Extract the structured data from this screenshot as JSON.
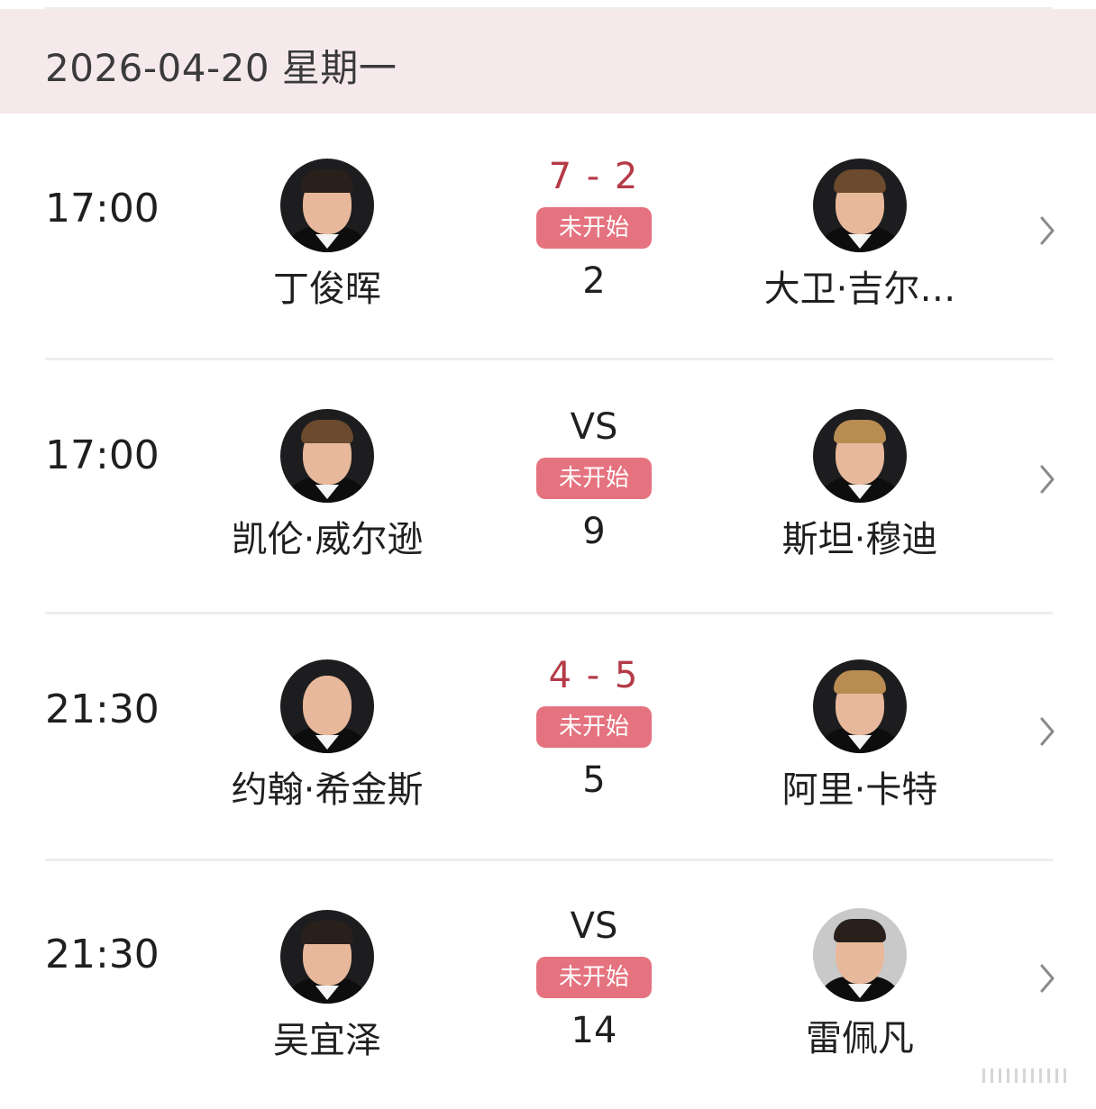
{
  "header": {
    "date": "2026-04-20 星期一"
  },
  "colors": {
    "header_bg": "#f6e9ec",
    "score": "#b53a47",
    "status_badge": "#e5737f",
    "divider": "#ededed"
  },
  "matches": [
    {
      "time": "17:00",
      "player_left": {
        "name": "丁俊晖",
        "avatar": "player-photo"
      },
      "center": {
        "type": "score",
        "score": "7 - 2",
        "status": "未开始",
        "round": "2"
      },
      "player_right": {
        "name": "大卫·吉尔…",
        "avatar": "player-photo"
      },
      "chevron": "chevron-right-icon"
    },
    {
      "time": "17:00",
      "player_left": {
        "name": "凯伦·威尔逊",
        "avatar": "player-photo"
      },
      "center": {
        "type": "vs",
        "score": "VS",
        "status": "未开始",
        "round": "9"
      },
      "player_right": {
        "name": "斯坦·穆迪",
        "avatar": "player-photo"
      },
      "chevron": "chevron-right-icon"
    },
    {
      "time": "21:30",
      "player_left": {
        "name": "约翰·希金斯",
        "avatar": "player-photo"
      },
      "center": {
        "type": "score",
        "score": "4 - 5",
        "status": "未开始",
        "round": "5"
      },
      "player_right": {
        "name": "阿里·卡特",
        "avatar": "player-photo"
      },
      "chevron": "chevron-right-icon"
    },
    {
      "time": "21:30",
      "player_left": {
        "name": "吴宜泽",
        "avatar": "player-photo"
      },
      "center": {
        "type": "vs",
        "score": "VS",
        "status": "未开始",
        "round": "14"
      },
      "player_right": {
        "name": "雷佩凡",
        "avatar": "player-photo"
      },
      "chevron": "chevron-right-icon"
    }
  ]
}
